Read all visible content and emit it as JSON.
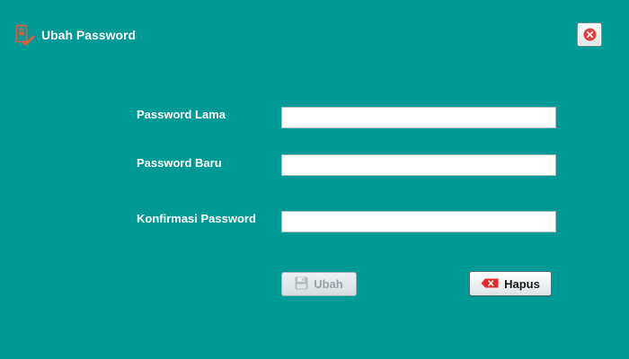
{
  "dialog": {
    "title": "Ubah Password",
    "title_icon": "password-change-icon",
    "close_icon": "close-icon",
    "accent_color": "#009A96",
    "close_color": "#E04040"
  },
  "form": {
    "fields": [
      {
        "label": "Password Lama",
        "value": ""
      },
      {
        "label": "Password Baru",
        "value": ""
      },
      {
        "label": "Konfirmasi Password",
        "value": ""
      }
    ]
  },
  "buttons": {
    "ubah": {
      "label": "Ubah",
      "icon": "save-icon",
      "enabled": false
    },
    "hapus": {
      "label": "Hapus",
      "icon": "erase-icon",
      "enabled": true
    }
  }
}
